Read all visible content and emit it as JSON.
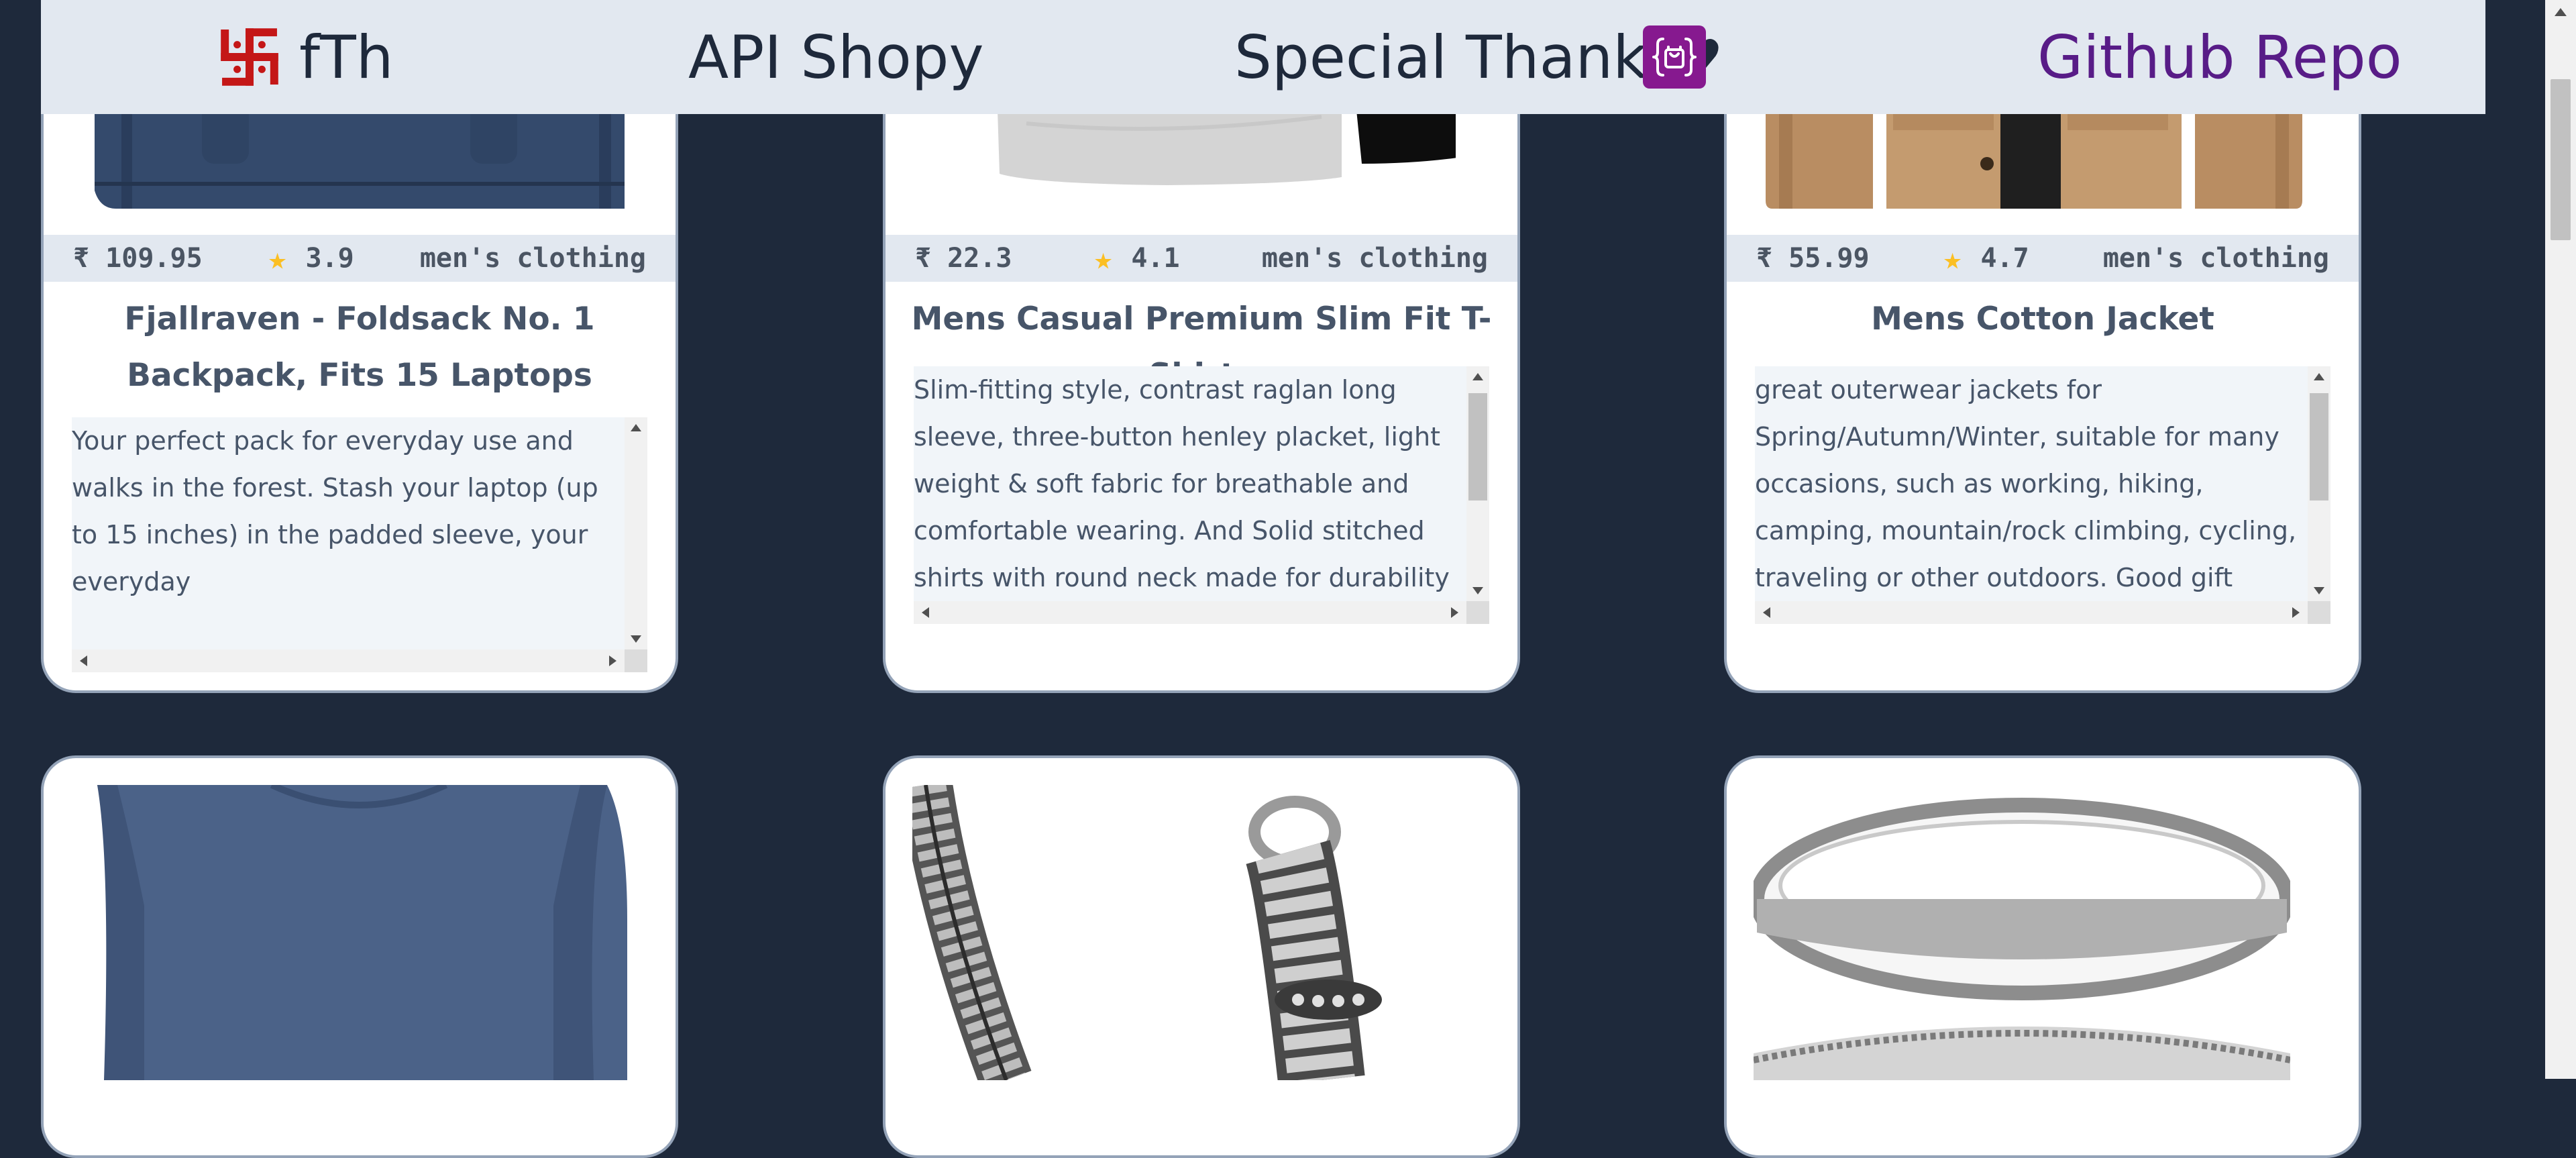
{
  "navbar": {
    "brand_text": "fTh",
    "links": {
      "api": "API Shopy",
      "thanks": "Special Thanks",
      "github": "Github Repo"
    }
  },
  "colors": {
    "page_bg": "#1e293b",
    "navbar_bg": "#e2e8f0",
    "brand_icon": "#c41717",
    "bag_icon_bg": "#86198f",
    "github_link": "#581c87",
    "star": "#fbbf24"
  },
  "icons": {
    "brand": "swastika-icon",
    "heart": "heart-icon",
    "bag": "shopping-bag-icon",
    "rating": "star-icon"
  },
  "products": [
    {
      "price": "₹ 109.95",
      "rating": "3.9",
      "category": "men's clothing",
      "title": "Fjallraven - Foldsack No. 1 Backpack, Fits 15 Laptops",
      "description": "Your perfect pack for everyday use and walks in the forest. Stash your laptop (up to 15 inches) in the padded sleeve, your everyday"
    },
    {
      "price": "₹ 22.3",
      "rating": "4.1",
      "category": "men's clothing",
      "title": "Mens Casual Premium Slim Fit T-Shirts",
      "description": "Slim-fitting style, contrast raglan long sleeve, three-button henley placket, light weight & soft fabric for breathable and comfortable wearing. And Solid stitched shirts with round neck made for durability and a great fit for"
    },
    {
      "price": "₹ 55.99",
      "rating": "4.7",
      "category": "men's clothing",
      "title": "Mens Cotton Jacket",
      "description": "great outerwear jackets for Spring/Autumn/Winter, suitable for many occasions, such as working, hiking, camping, mountain/rock climbing, cycling, traveling or other outdoors. Good gift choice for you or"
    }
  ]
}
